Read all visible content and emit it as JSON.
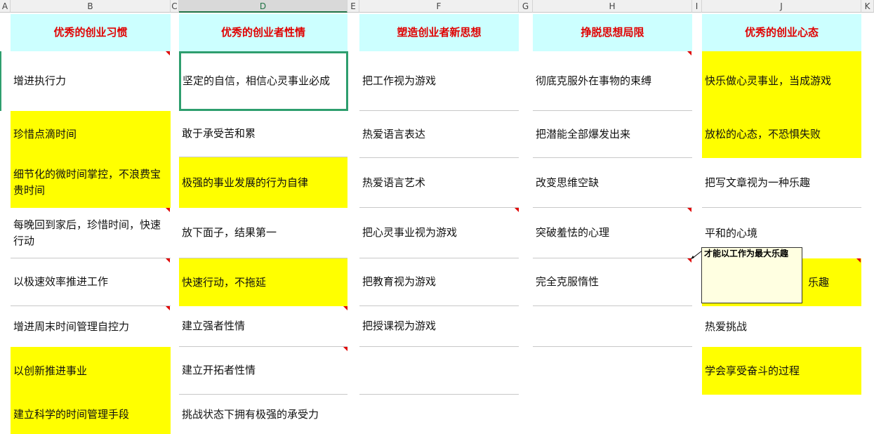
{
  "columns": [
    "A",
    "B",
    "C",
    "D",
    "E",
    "F",
    "G",
    "H",
    "I",
    "J",
    "K"
  ],
  "sheet": {
    "B": {
      "header": "优秀的创业习惯",
      "cells": [
        "增进执行力",
        "珍惜点滴时间",
        "细节化的微时间掌控，不浪费宝贵时间",
        "每晚回到家后，珍惜时间，快速行动",
        "以极速效率推进工作",
        "增进周末时间管理自控力",
        "以创新推进事业",
        "建立科学的时间管理手段"
      ]
    },
    "D": {
      "header": "优秀的创业者性情",
      "cells": [
        "坚定的自信，相信心灵事业必成",
        "敢于承受苦和累",
        "极强的事业发展的行为自律",
        "放下面子，结果第一",
        "快速行动，不拖延",
        "建立强者性情",
        "建立开拓者性情",
        "挑战状态下拥有极强的承受力"
      ]
    },
    "F": {
      "header": "塑造创业者新思想",
      "cells": [
        "把工作视为游戏",
        "热爱语言表达",
        "热爱语言艺术",
        "把心灵事业视为游戏",
        "把教育视为游戏",
        "把授课视为游戏"
      ]
    },
    "H": {
      "header": "挣脱思想局限",
      "cells": [
        "彻底克服外在事物的束缚",
        "把潜能全部爆发出来",
        "改变思维空缺",
        "突破羞怯的心理",
        "完全克服惰性"
      ]
    },
    "J": {
      "header": "优秀的创业心态",
      "cells": [
        "快乐做心灵事业，当成游戏",
        "放松的心态，不恐惧失败",
        "把写文章视为一种乐趣",
        "平和的心境",
        "乐趣",
        "热爱挑战",
        "学会享受奋斗的过程"
      ]
    }
  },
  "comment": {
    "text": "才能以工作为最大乐趣"
  },
  "colors": {
    "header_bg": "#ccffff",
    "header_text": "#e00000",
    "highlight": "#ffff00",
    "selection": "#2e9e6e"
  },
  "selected_column": "D"
}
